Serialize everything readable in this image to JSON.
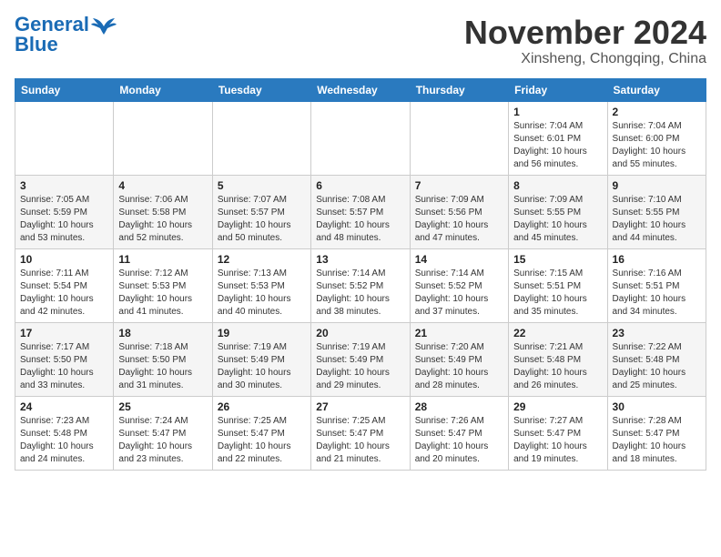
{
  "header": {
    "logo_line1": "General",
    "logo_line2": "Blue",
    "month": "November 2024",
    "location": "Xinsheng, Chongqing, China"
  },
  "weekdays": [
    "Sunday",
    "Monday",
    "Tuesday",
    "Wednesday",
    "Thursday",
    "Friday",
    "Saturday"
  ],
  "weeks": [
    [
      {
        "day": "",
        "info": ""
      },
      {
        "day": "",
        "info": ""
      },
      {
        "day": "",
        "info": ""
      },
      {
        "day": "",
        "info": ""
      },
      {
        "day": "",
        "info": ""
      },
      {
        "day": "1",
        "info": "Sunrise: 7:04 AM\nSunset: 6:01 PM\nDaylight: 10 hours and 56 minutes."
      },
      {
        "day": "2",
        "info": "Sunrise: 7:04 AM\nSunset: 6:00 PM\nDaylight: 10 hours and 55 minutes."
      }
    ],
    [
      {
        "day": "3",
        "info": "Sunrise: 7:05 AM\nSunset: 5:59 PM\nDaylight: 10 hours and 53 minutes."
      },
      {
        "day": "4",
        "info": "Sunrise: 7:06 AM\nSunset: 5:58 PM\nDaylight: 10 hours and 52 minutes."
      },
      {
        "day": "5",
        "info": "Sunrise: 7:07 AM\nSunset: 5:57 PM\nDaylight: 10 hours and 50 minutes."
      },
      {
        "day": "6",
        "info": "Sunrise: 7:08 AM\nSunset: 5:57 PM\nDaylight: 10 hours and 48 minutes."
      },
      {
        "day": "7",
        "info": "Sunrise: 7:09 AM\nSunset: 5:56 PM\nDaylight: 10 hours and 47 minutes."
      },
      {
        "day": "8",
        "info": "Sunrise: 7:09 AM\nSunset: 5:55 PM\nDaylight: 10 hours and 45 minutes."
      },
      {
        "day": "9",
        "info": "Sunrise: 7:10 AM\nSunset: 5:55 PM\nDaylight: 10 hours and 44 minutes."
      }
    ],
    [
      {
        "day": "10",
        "info": "Sunrise: 7:11 AM\nSunset: 5:54 PM\nDaylight: 10 hours and 42 minutes."
      },
      {
        "day": "11",
        "info": "Sunrise: 7:12 AM\nSunset: 5:53 PM\nDaylight: 10 hours and 41 minutes."
      },
      {
        "day": "12",
        "info": "Sunrise: 7:13 AM\nSunset: 5:53 PM\nDaylight: 10 hours and 40 minutes."
      },
      {
        "day": "13",
        "info": "Sunrise: 7:14 AM\nSunset: 5:52 PM\nDaylight: 10 hours and 38 minutes."
      },
      {
        "day": "14",
        "info": "Sunrise: 7:14 AM\nSunset: 5:52 PM\nDaylight: 10 hours and 37 minutes."
      },
      {
        "day": "15",
        "info": "Sunrise: 7:15 AM\nSunset: 5:51 PM\nDaylight: 10 hours and 35 minutes."
      },
      {
        "day": "16",
        "info": "Sunrise: 7:16 AM\nSunset: 5:51 PM\nDaylight: 10 hours and 34 minutes."
      }
    ],
    [
      {
        "day": "17",
        "info": "Sunrise: 7:17 AM\nSunset: 5:50 PM\nDaylight: 10 hours and 33 minutes."
      },
      {
        "day": "18",
        "info": "Sunrise: 7:18 AM\nSunset: 5:50 PM\nDaylight: 10 hours and 31 minutes."
      },
      {
        "day": "19",
        "info": "Sunrise: 7:19 AM\nSunset: 5:49 PM\nDaylight: 10 hours and 30 minutes."
      },
      {
        "day": "20",
        "info": "Sunrise: 7:19 AM\nSunset: 5:49 PM\nDaylight: 10 hours and 29 minutes."
      },
      {
        "day": "21",
        "info": "Sunrise: 7:20 AM\nSunset: 5:49 PM\nDaylight: 10 hours and 28 minutes."
      },
      {
        "day": "22",
        "info": "Sunrise: 7:21 AM\nSunset: 5:48 PM\nDaylight: 10 hours and 26 minutes."
      },
      {
        "day": "23",
        "info": "Sunrise: 7:22 AM\nSunset: 5:48 PM\nDaylight: 10 hours and 25 minutes."
      }
    ],
    [
      {
        "day": "24",
        "info": "Sunrise: 7:23 AM\nSunset: 5:48 PM\nDaylight: 10 hours and 24 minutes."
      },
      {
        "day": "25",
        "info": "Sunrise: 7:24 AM\nSunset: 5:47 PM\nDaylight: 10 hours and 23 minutes."
      },
      {
        "day": "26",
        "info": "Sunrise: 7:25 AM\nSunset: 5:47 PM\nDaylight: 10 hours and 22 minutes."
      },
      {
        "day": "27",
        "info": "Sunrise: 7:25 AM\nSunset: 5:47 PM\nDaylight: 10 hours and 21 minutes."
      },
      {
        "day": "28",
        "info": "Sunrise: 7:26 AM\nSunset: 5:47 PM\nDaylight: 10 hours and 20 minutes."
      },
      {
        "day": "29",
        "info": "Sunrise: 7:27 AM\nSunset: 5:47 PM\nDaylight: 10 hours and 19 minutes."
      },
      {
        "day": "30",
        "info": "Sunrise: 7:28 AM\nSunset: 5:47 PM\nDaylight: 10 hours and 18 minutes."
      }
    ]
  ]
}
